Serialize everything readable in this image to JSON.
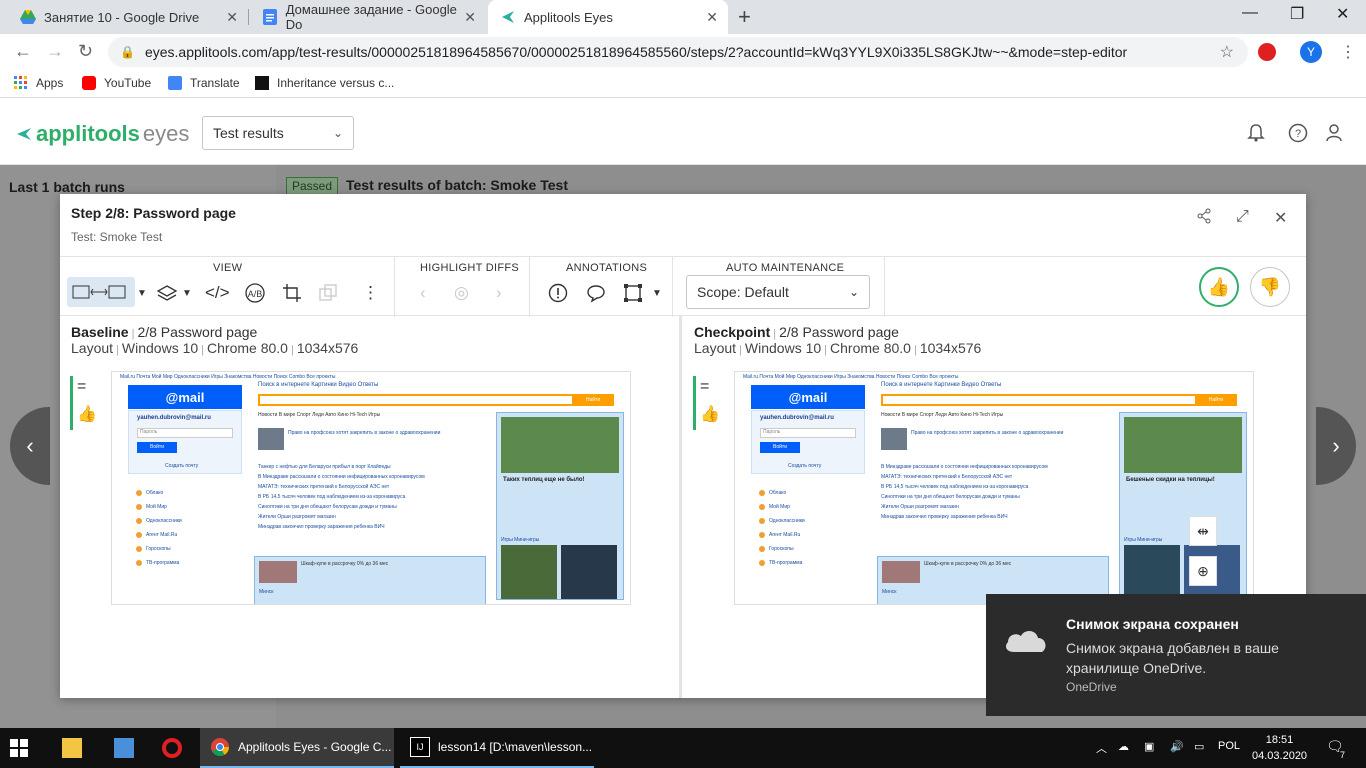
{
  "browser": {
    "tabs": [
      {
        "title": "Занятие 10 - Google Drive"
      },
      {
        "title": "Домашнее задание - Google Do"
      },
      {
        "title": "Applitools Eyes"
      }
    ],
    "url": "eyes.applitools.com/app/test-results/00000251818964585670/00000251818964585560/steps/2?accountId=kWq3YYL9X0i335LS8GKJtw~~&mode=step-editor",
    "profile_initial": "Y",
    "bookmarks": [
      "Apps",
      "YouTube",
      "Translate",
      "Inheritance versus c..."
    ]
  },
  "app": {
    "logo_main": "applitools",
    "logo_eyes": "eyes",
    "results_select": "Test results"
  },
  "background": {
    "left_title": "Last 1 batch runs",
    "status": "Passed",
    "batch_title": "Test results of batch:  Smoke Test"
  },
  "modal": {
    "title": "Step 2/8:  Password page",
    "subtitle": "Test: Smoke Test",
    "groups": {
      "view": "VIEW",
      "highlight": "HIGHLIGHT DIFFS",
      "annotations": "ANNOTATIONS",
      "maintenance": "AUTO MAINTENANCE"
    },
    "scope": "Scope: Default",
    "baseline": {
      "label": "Baseline",
      "step": "2/8 Password page",
      "layout": "Layout",
      "os": "Windows 10",
      "browser": "Chrome 80.0",
      "size": "1034x576"
    },
    "checkpoint": {
      "label": "Checkpoint",
      "step": "2/8 Password page",
      "layout": "Layout",
      "os": "Windows 10",
      "browser": "Chrome 80.0",
      "size": "1034x576"
    }
  },
  "screenshot": {
    "topnav": "Mail.ru   Почта   Мой Мир   Одноклассники   Игры   Знакомства   Новости   Поиск   Combo   Все проекты",
    "logo": "@mail",
    "user": "yauhen.dubrovin@mail.ru",
    "password_placeholder": "Пароль",
    "enter": "Войти",
    "create": "Создать почту",
    "services": [
      "Облако",
      "Мой Мир",
      "Одноклассники",
      "Агент Mail.Ru",
      "Гороскопы",
      "ТВ-программа"
    ],
    "search_header": "Поиск в интернете    Картинки    Видео    Ответы",
    "find": "Найти",
    "news_tabs": "Новости    В мире    Спорт    Леди    Авто    Кино    Hi-Tech    Игры",
    "news_lines": [
      "Право на профсоюз хотят закрепить в законе о здравоохранении",
      "Танкер с нефтью для Беларуси прибыл в порт Клайпеды",
      "В Минздраве рассказали о состоянии инфицированных коронавирусом",
      "МАГАТЭ: технических претензий к Белорусской АЭС нет",
      "В РБ 14,5 тысяч человек под наблюдением из-за коронавируса",
      "Синоптики на три дня обещают белорусам дожди и туманы",
      "Жители Орши разгромят магазин",
      "Минздрав закончил проверку заражения ребенка ВИЧ"
    ],
    "baseline_ad": "Таких теплиц еще не было!",
    "checkpoint_ad": "Бешеные скидки на теплицы!",
    "games": "Игры     Мини-игры",
    "bottom_card": "Шкаф-купе в рассрочку 0% до 36 мес",
    "city": "Минск"
  },
  "toast": {
    "title": "Снимок экрана сохранен",
    "body": "Снимок экрана добавлен в ваше хранилище OneDrive.",
    "source": "OneDrive"
  },
  "taskbar": {
    "chrome": "Applitools Eyes - Google C...",
    "idea": "lesson14 [D:\\maven\\lesson...",
    "lang": "POL",
    "time": "18:51",
    "date": "04.03.2020",
    "notif_count": "7"
  }
}
